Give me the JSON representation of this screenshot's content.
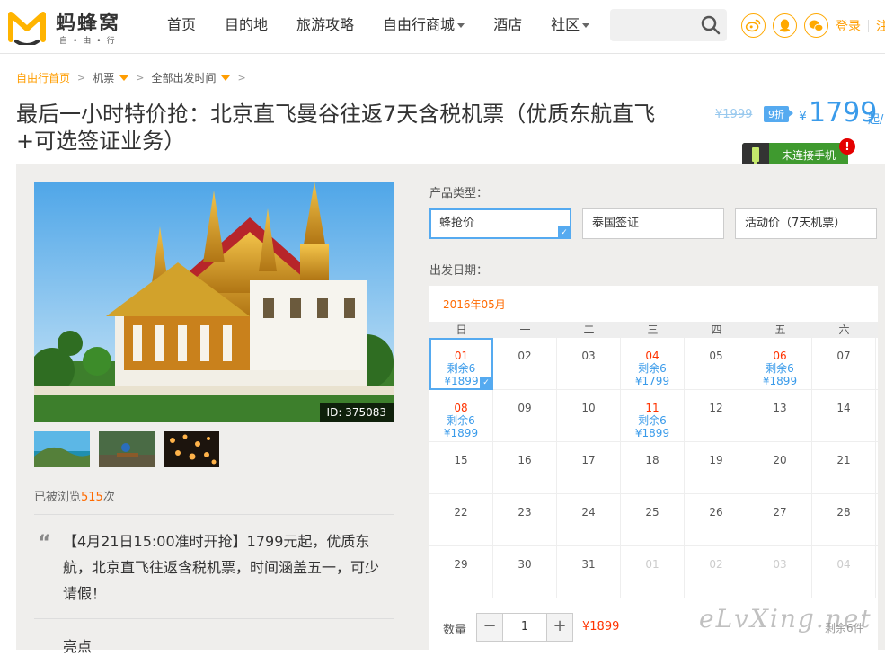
{
  "logo": {
    "name": "蚂蜂窝",
    "sub": "自•由•行"
  },
  "nav": [
    {
      "label": "首页",
      "caret": false
    },
    {
      "label": "目的地",
      "caret": false
    },
    {
      "label": "旅游攻略",
      "caret": false
    },
    {
      "label": "自由行商城",
      "caret": true
    },
    {
      "label": "酒店",
      "caret": false
    },
    {
      "label": "社区",
      "caret": true
    }
  ],
  "search": {
    "placeholder": ""
  },
  "auth": {
    "login": "登录",
    "register": "注"
  },
  "breadcrumb": {
    "home": "自由行首页",
    "cat": "机票",
    "time": "全部出发时间"
  },
  "title": "最后一小时特价抢：北京直飞曼谷往返7天含税机票（优质东航直飞+可选签证业务）",
  "price": {
    "old": "¥1999",
    "discount": "9折",
    "yen": "¥",
    "value": "1799",
    "unit": "起/"
  },
  "phone_button": "未连接手机",
  "hero": {
    "id_label": "ID: 375083"
  },
  "views": {
    "prefix": "已被浏览",
    "count": "515",
    "suffix": "次"
  },
  "quote": "【4月21日15:00准时开抢】1799元起，优质东航，北京直飞往返含税机票，时间涵盖五一，可少请假！",
  "highlight_label": "亮点",
  "product_type_label": "产品类型：",
  "types": [
    "蜂抢价",
    "泰国签证",
    "活动价（7天机票）"
  ],
  "date_label": "出发日期：",
  "calendar": {
    "month": "2016年05月",
    "weekdays": [
      "日",
      "一",
      "二",
      "三",
      "四",
      "五",
      "六"
    ],
    "rows": [
      [
        {
          "d": "01",
          "s": "剩余6",
          "p": "¥1899",
          "sel": true
        },
        {
          "d": "02"
        },
        {
          "d": "03"
        },
        {
          "d": "04",
          "s": "剩余6",
          "p": "¥1799"
        },
        {
          "d": "05"
        },
        {
          "d": "06",
          "s": "剩余6",
          "p": "¥1899"
        },
        {
          "d": "07"
        }
      ],
      [
        {
          "d": "08",
          "s": "剩余6",
          "p": "¥1899"
        },
        {
          "d": "09"
        },
        {
          "d": "10"
        },
        {
          "d": "11",
          "s": "剩余6",
          "p": "¥1899"
        },
        {
          "d": "12"
        },
        {
          "d": "13"
        },
        {
          "d": "14"
        }
      ],
      [
        {
          "d": "15"
        },
        {
          "d": "16"
        },
        {
          "d": "17"
        },
        {
          "d": "18"
        },
        {
          "d": "19"
        },
        {
          "d": "20"
        },
        {
          "d": "21"
        }
      ],
      [
        {
          "d": "22"
        },
        {
          "d": "23"
        },
        {
          "d": "24"
        },
        {
          "d": "25"
        },
        {
          "d": "26"
        },
        {
          "d": "27"
        },
        {
          "d": "28"
        }
      ],
      [
        {
          "d": "29"
        },
        {
          "d": "30"
        },
        {
          "d": "31"
        },
        {
          "d": "01",
          "muted": true
        },
        {
          "d": "02",
          "muted": true
        },
        {
          "d": "03",
          "muted": true
        },
        {
          "d": "04",
          "muted": true
        }
      ]
    ]
  },
  "quantity": {
    "label": "数量",
    "minus": "−",
    "plus": "+",
    "value": "1",
    "price": "¥1899",
    "stock": "剩余6件"
  },
  "watermark": "eLvXing.net"
}
